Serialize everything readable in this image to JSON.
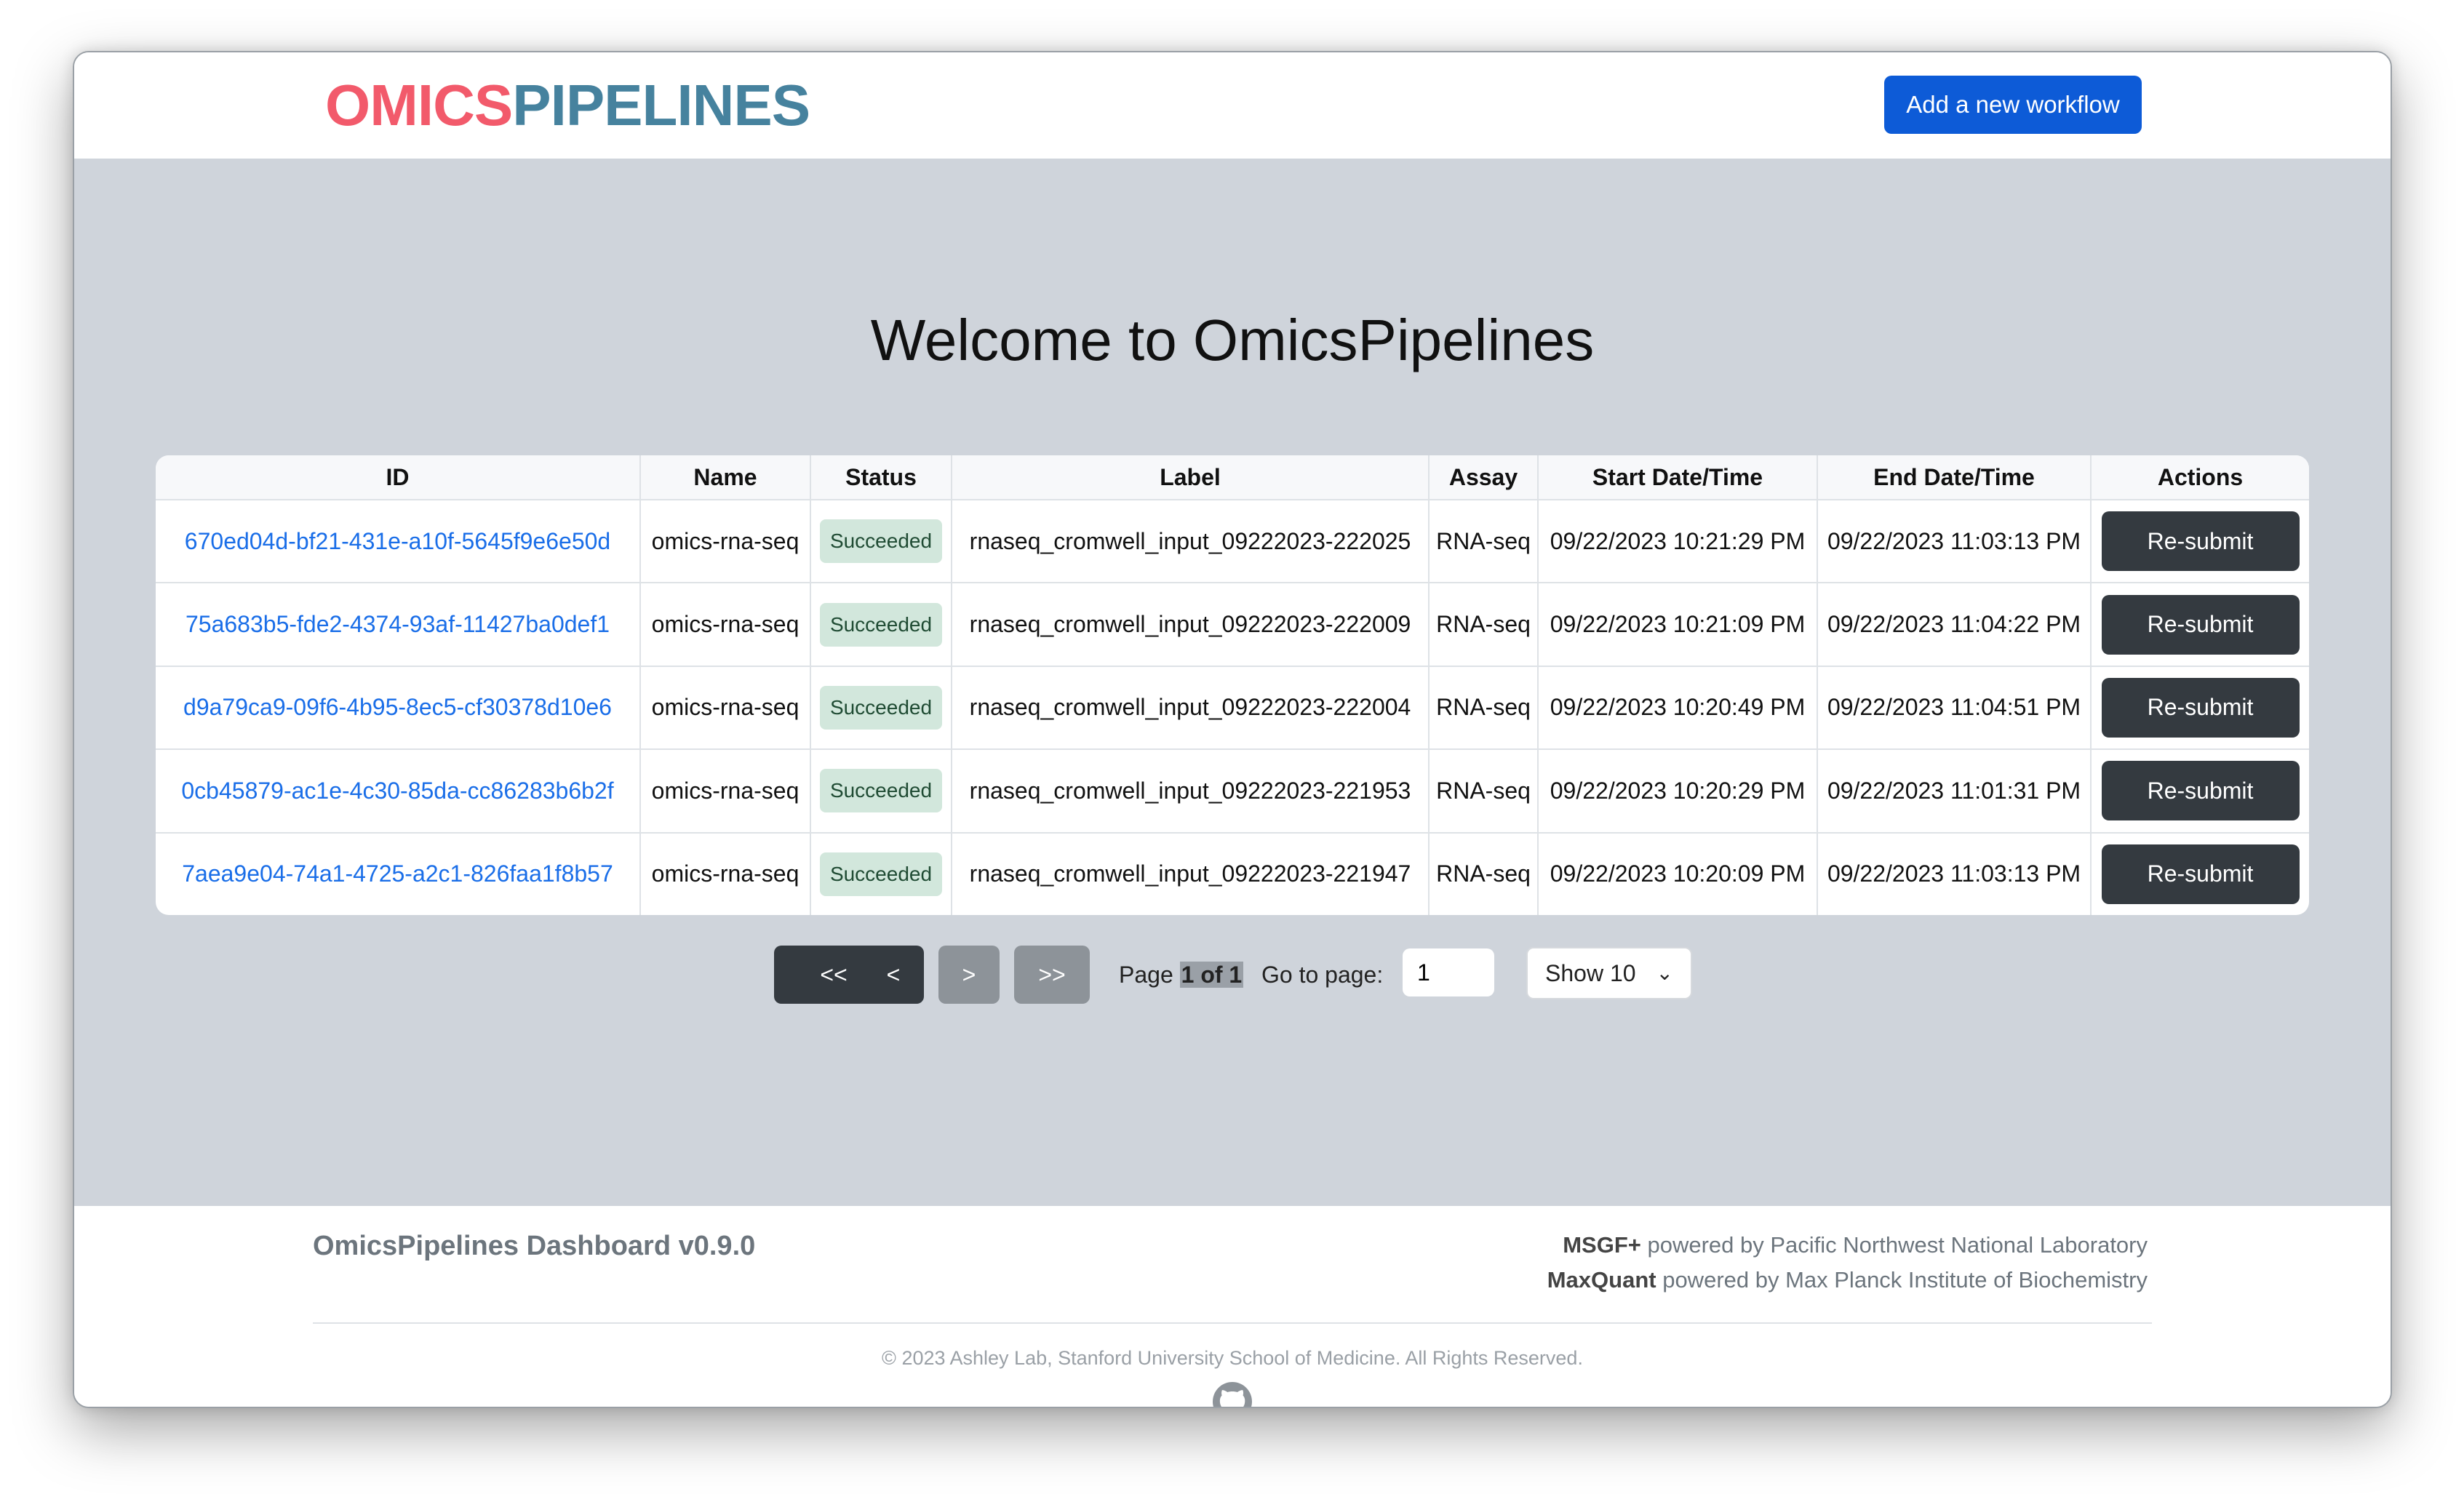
{
  "header": {
    "logo_part1": "OMICS",
    "logo_part2": "PIPELINES",
    "add_workflow_label": "Add a new workflow"
  },
  "main": {
    "title": "Welcome to OmicsPipelines"
  },
  "table": {
    "columns": [
      "ID",
      "Name",
      "Status",
      "Label",
      "Assay",
      "Start Date/Time",
      "End Date/Time",
      "Actions"
    ],
    "rows": [
      {
        "id": "670ed04d-bf21-431e-a10f-5645f9e6e50d",
        "name": "omics-rna-seq",
        "status": "Succeeded",
        "label": "rnaseq_cromwell_input_09222023-222025",
        "assay": "RNA-seq",
        "start": "09/22/2023 10:21:29 PM",
        "end": "09/22/2023 11:03:13 PM",
        "action": "Re-submit"
      },
      {
        "id": "75a683b5-fde2-4374-93af-11427ba0def1",
        "name": "omics-rna-seq",
        "status": "Succeeded",
        "label": "rnaseq_cromwell_input_09222023-222009",
        "assay": "RNA-seq",
        "start": "09/22/2023 10:21:09 PM",
        "end": "09/22/2023 11:04:22 PM",
        "action": "Re-submit"
      },
      {
        "id": "d9a79ca9-09f6-4b95-8ec5-cf30378d10e6",
        "name": "omics-rna-seq",
        "status": "Succeeded",
        "label": "rnaseq_cromwell_input_09222023-222004",
        "assay": "RNA-seq",
        "start": "09/22/2023 10:20:49 PM",
        "end": "09/22/2023 11:04:51 PM",
        "action": "Re-submit"
      },
      {
        "id": "0cb45879-ac1e-4c30-85da-cc86283b6b2f",
        "name": "omics-rna-seq",
        "status": "Succeeded",
        "label": "rnaseq_cromwell_input_09222023-221953",
        "assay": "RNA-seq",
        "start": "09/22/2023 10:20:29 PM",
        "end": "09/22/2023 11:01:31 PM",
        "action": "Re-submit"
      },
      {
        "id": "7aea9e04-74a1-4725-a2c1-826faa1f8b57",
        "name": "omics-rna-seq",
        "status": "Succeeded",
        "label": "rnaseq_cromwell_input_09222023-221947",
        "assay": "RNA-seq",
        "start": "09/22/2023 10:20:09 PM",
        "end": "09/22/2023 11:03:13 PM",
        "action": "Re-submit"
      }
    ]
  },
  "pagination": {
    "first": "<<",
    "prev": "<",
    "next": ">",
    "last": ">>",
    "page_prefix": "Page",
    "page_value": "1 of 1",
    "goto_label": "Go to page:",
    "goto_value": "1",
    "show_label": "Show 10"
  },
  "footer": {
    "brand": "OmicsPipelines Dashboard v0.9.0",
    "credit1_strong": "MSGF+",
    "credit1_rest": "powered by Pacific Northwest National Laboratory",
    "credit2_strong": "MaxQuant",
    "credit2_rest": "powered by Max Planck Institute of Biochemistry",
    "copyright": "© 2023 Ashley Lab, Stanford University School of Medicine. All Rights Reserved.",
    "github_icon": "github-icon"
  },
  "colors": {
    "accent": "#0d5bd7",
    "logo_red": "#f25a6b",
    "logo_blue": "#46829e",
    "success_badge": "#d2e7dc",
    "main_bg": "#cfd4db"
  }
}
